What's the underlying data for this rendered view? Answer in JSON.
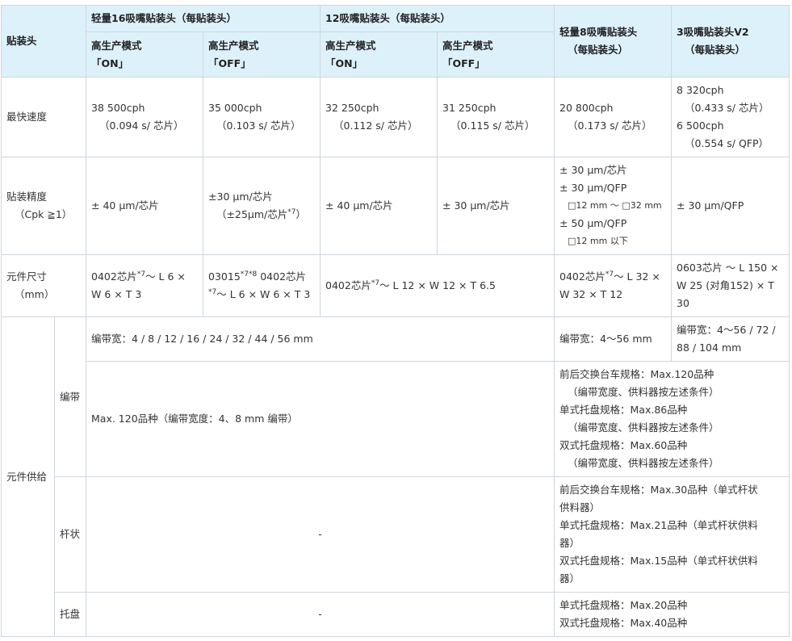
{
  "header": {
    "row_label": "贴装头",
    "head16": "轻量16吸嘴贴装头（每贴装头）",
    "head12": "12吸嘴贴装头（每贴装头）",
    "head8": [
      "轻量8吸嘴贴装头",
      "（每贴装头）"
    ],
    "head3": [
      "3吸嘴贴装头V2",
      "（每贴装头）"
    ],
    "mode_on": [
      "高生产模式",
      "「ON」"
    ],
    "mode_off": [
      "高生产模式",
      "「OFF」"
    ]
  },
  "speed": {
    "label": "最快速度",
    "h16_on": [
      "38 500cph",
      "（0.094 s/ 芯片）"
    ],
    "h16_off": [
      "35 000cph",
      "（0.103 s/ 芯片）"
    ],
    "h12_on": [
      "32 250cph",
      "（0.112 s/ 芯片）"
    ],
    "h12_off": [
      "31 250cph",
      "（0.115 s/ 芯片）"
    ],
    "h8": [
      "20 800cph",
      "（0.173 s/ 芯片）"
    ],
    "h3": [
      "8 320cph",
      "（0.433 s/ 芯片）",
      "6 500cph",
      "（0.554 s/ QFP）"
    ]
  },
  "accuracy": {
    "label": [
      "贴装精度",
      "（Cpk ≧1）"
    ],
    "h16_on": "± 40 μm/芯片",
    "h16_off": [
      "±30 μm/芯片",
      "（±25μm/芯片",
      "*7",
      "）"
    ],
    "h12_on": "± 40 μm/芯片",
    "h12_off": "± 30 μm/芯片",
    "h8": [
      "± 30 μm/芯片",
      "± 30 μm/QFP",
      "□12 mm ～ □32 mm",
      "± 50 μm/QFP",
      "□12 mm 以下"
    ],
    "h3": "± 30 μm/QFP"
  },
  "size": {
    "label": [
      "元件尺寸",
      "（mm）"
    ],
    "h16_on": [
      "0402芯片",
      "*7",
      "～ L 6 ×",
      "W 6 × T 3"
    ],
    "h16_off": [
      "03015",
      "*7*8",
      " 0402芯片",
      "*7",
      "～ L 6 × W 6 × T 3"
    ],
    "h12": [
      "0402芯片",
      "*7",
      "～ L 12 × W 12 × T 6.5"
    ],
    "h8": [
      "0402芯片",
      "*7",
      "～ L 32 ×",
      "W 32 × T 12"
    ],
    "h3": [
      "0603芯片 ～ L 150 ×",
      "W 25 (对角152) × T",
      "30"
    ]
  },
  "supply": {
    "label": "元件供给",
    "tape_label": "编带",
    "stick_label": "杆状",
    "tray_label": "托盘",
    "tape_width_main": "编带宽：4 / 8 / 12 / 16 / 24 / 32 / 44 / 56 mm",
    "tape_width_h8": "编带宽：4～56 mm",
    "tape_width_h3": [
      "编带宽：4～56 / 72 /",
      "88 / 104 mm"
    ],
    "tape_qty_main": "Max. 120品种（编带宽度：4、8 mm 编带）",
    "tape_qty_right": [
      "前后交换台车规格：Max.120品种",
      "（编带宽度、供料器按左述条件）",
      "单式托盘规格：Max.86品种",
      "（编带宽度、供料器按左述条件）",
      "双式托盘规格：Max.60品种",
      "（编带宽度、供料器按左述条件）"
    ],
    "stick_main": "-",
    "stick_right": [
      "前后交换台车规格：Max.30品种（单式杆状",
      "供料器）",
      "单式托盘规格：Max.21品种（单式杆状供料",
      "器）",
      "双式托盘规格：Max.15品种（单式杆状供料",
      "器）"
    ],
    "tray_main": "-",
    "tray_right": [
      "单式托盘规格：Max.20品种",
      "双式托盘规格：Max.40品种"
    ]
  }
}
